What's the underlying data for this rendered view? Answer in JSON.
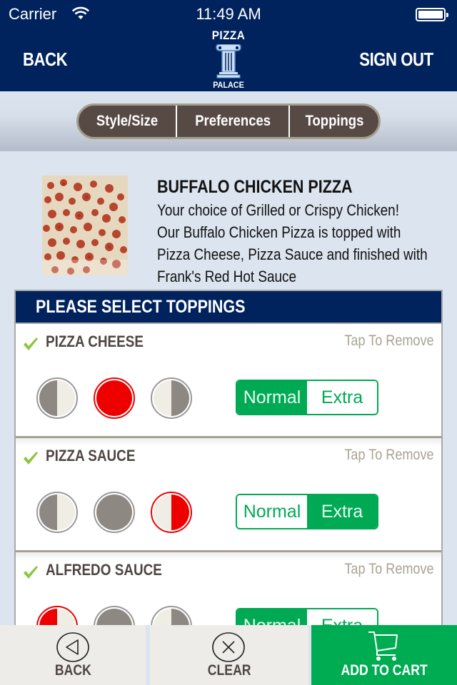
{
  "status_bar": {
    "carrier": "Carrier",
    "time": "11:49 AM"
  },
  "header": {
    "back_label": "BACK",
    "sign_out_label": "SIGN OUT",
    "logo_top": "PIZZA",
    "logo_bottom": "PALACE"
  },
  "tabs": [
    {
      "label": "Style/Size"
    },
    {
      "label": "Preferences"
    },
    {
      "label": "Toppings"
    }
  ],
  "product": {
    "title": "BUFFALO CHICKEN PIZZA",
    "description_lines": [
      "Your choice of Grilled or Crispy Chicken!",
      "Our Buffalo Chicken Pizza is topped with",
      "Pizza Cheese, Pizza Sauce and finished with",
      "Frank's Red Hot Sauce"
    ]
  },
  "toppings_panel": {
    "title": "PLEASE SELECT TOPPINGS",
    "items": [
      {
        "name": "PIZZA CHEESE",
        "remove_label": "Tap To Remove",
        "selected_portion": "whole",
        "amount_options": [
          "Normal",
          "Extra"
        ],
        "selected_amount": "Normal"
      },
      {
        "name": "PIZZA SAUCE",
        "remove_label": "Tap To Remove",
        "selected_portion": "right",
        "amount_options": [
          "Normal",
          "Extra"
        ],
        "selected_amount": "Extra"
      },
      {
        "name": "ALFREDO SAUCE",
        "remove_label": "Tap To Remove",
        "selected_portion": "left",
        "amount_options": [
          "Normal",
          "Extra"
        ],
        "selected_amount": "Normal"
      }
    ]
  },
  "bottom_bar": {
    "back_label": "BACK",
    "clear_label": "CLEAR",
    "add_to_cart_label": "ADD TO CART"
  },
  "colors": {
    "navy": "#00235d",
    "green": "#00aa55",
    "red": "#ee0000",
    "segment_bg": "#574a45",
    "gray_half": "#8e8883",
    "cream_half": "#efede4"
  }
}
